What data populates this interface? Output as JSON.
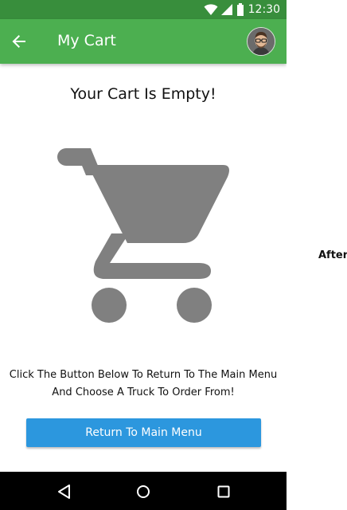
{
  "status_bar": {
    "time": "12:30",
    "icons": [
      "wifi-icon",
      "cell-signal-icon",
      "battery-icon"
    ]
  },
  "app_bar": {
    "title": "My Cart",
    "back_icon": "arrow-back-icon",
    "avatar": "user-avatar",
    "color": "#4caf50"
  },
  "cart": {
    "empty_title": "Your Cart Is Empty!",
    "icon": "shopping-cart-icon",
    "icon_color": "#808080",
    "instructions_line1": "Click The Button Below To Return To The Main Menu",
    "instructions_line2": "And Choose A Truck To Order From!",
    "return_button_label": "Return To Main Menu",
    "button_color": "#2c97de"
  },
  "nav_bar": {
    "icons": [
      "back-triangle-icon",
      "home-circle-icon",
      "recents-square-icon"
    ]
  },
  "annotation": {
    "label": "After"
  }
}
